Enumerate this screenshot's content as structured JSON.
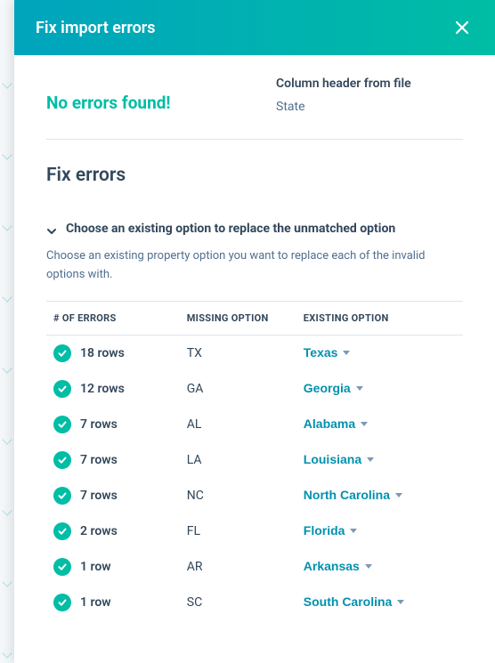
{
  "header": {
    "title": "Fix import errors"
  },
  "status": {
    "message": "No errors found!",
    "column_header_label": "Column header from file",
    "column_header_value": "State"
  },
  "section": {
    "title": "Fix errors"
  },
  "accordion": {
    "title": "Choose an existing option to replace the unmatched option",
    "description": "Choose an existing property option you want to replace each of the invalid options with."
  },
  "table": {
    "headers": {
      "errors": "# OF ERRORS",
      "missing": "MISSING OPTION",
      "existing": "EXISTING OPTION"
    },
    "rows": [
      {
        "count": "18 rows",
        "missing": "TX",
        "existing": "Texas"
      },
      {
        "count": "12 rows",
        "missing": "GA",
        "existing": "Georgia"
      },
      {
        "count": "7 rows",
        "missing": "AL",
        "existing": "Alabama"
      },
      {
        "count": "7 rows",
        "missing": "LA",
        "existing": "Louisiana"
      },
      {
        "count": "7 rows",
        "missing": "NC",
        "existing": "North Carolina"
      },
      {
        "count": "2 rows",
        "missing": "FL",
        "existing": "Florida"
      },
      {
        "count": "1 row",
        "missing": "AR",
        "existing": "Arkansas"
      },
      {
        "count": "1 row",
        "missing": "SC",
        "existing": "South Carolina"
      }
    ]
  }
}
